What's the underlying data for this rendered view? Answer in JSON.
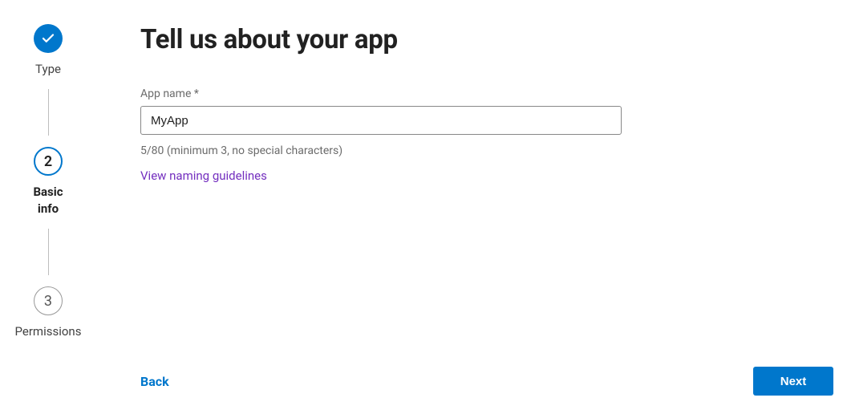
{
  "stepper": {
    "steps": [
      {
        "label": "Type",
        "state": "completed"
      },
      {
        "number": "2",
        "label": "Basic\ninfo",
        "state": "current"
      },
      {
        "number": "3",
        "label": "Permissions",
        "state": "upcoming"
      }
    ]
  },
  "main": {
    "title": "Tell us about your app",
    "appNameLabel": "App name *",
    "appNameValue": "MyApp",
    "helperText": "5/80 (minimum 3, no special characters)",
    "guidelinesLink": "View naming guidelines"
  },
  "footer": {
    "back": "Back",
    "next": "Next"
  }
}
